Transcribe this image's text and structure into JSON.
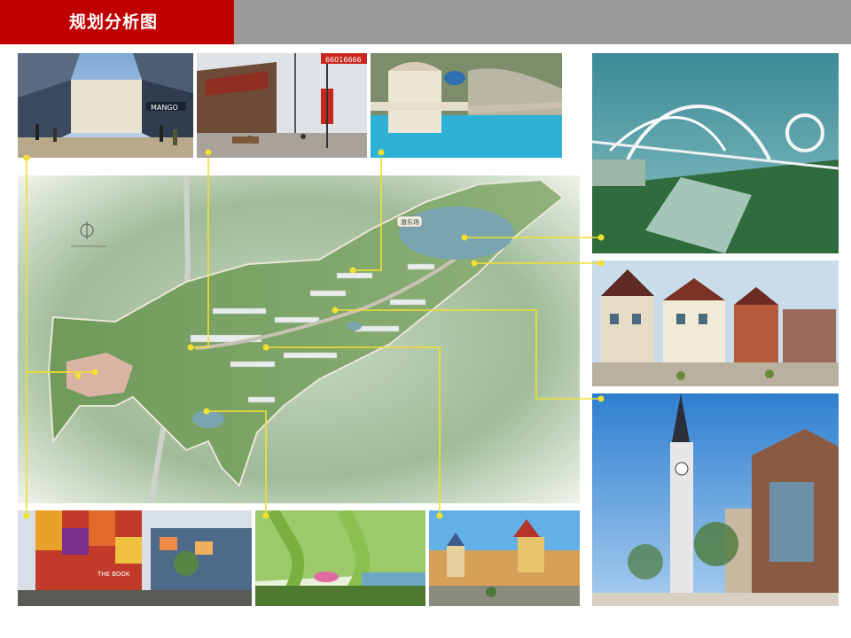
{
  "header": {
    "title": "规划分析图",
    "accent_color": "#c00000",
    "bar_color": "#9a9a9a"
  },
  "leader_color": "#f2e030",
  "plan": {
    "name": "master-site-plan",
    "badge_text": "游乐场"
  },
  "photos": [
    {
      "name": "photo-shopping-mall-interior",
      "sign_text": "MANGO"
    },
    {
      "name": "photo-pedestrian-street",
      "sign_text": "66016666"
    },
    {
      "name": "photo-pool-pavilion"
    },
    {
      "name": "photo-roller-coaster"
    },
    {
      "name": "photo-european-street-houses"
    },
    {
      "name": "photo-clock-tower-street"
    },
    {
      "name": "photo-colorful-commercial-building",
      "sign_text": "THE BOOK"
    },
    {
      "name": "photo-willow-park"
    },
    {
      "name": "photo-european-town-square"
    }
  ]
}
